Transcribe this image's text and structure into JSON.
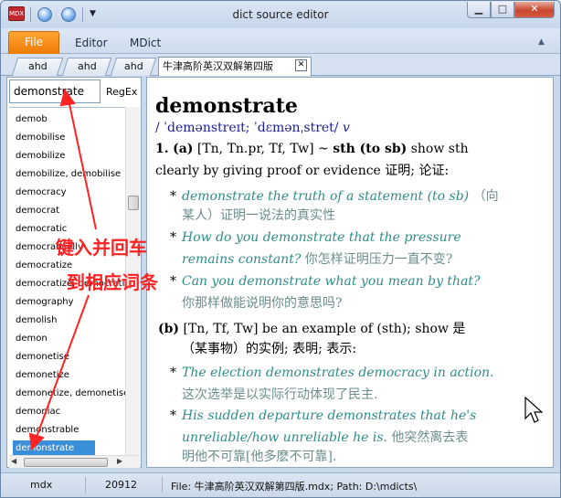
{
  "window": {
    "title": "dict source editor",
    "app_icon_text": "MDX"
  },
  "ribbon": {
    "file_tab": "File",
    "tabs": [
      "Editor",
      "MDict"
    ]
  },
  "doc_tabs": {
    "tabs": [
      "ahd",
      "ahd",
      "ahd"
    ],
    "active": "牛津高阶英汉双解第四版",
    "close_label": "✕"
  },
  "search": {
    "value": "demonstrate",
    "regex_label": "RegEx"
  },
  "word_list": [
    "demob",
    "demobilise",
    "demobilize",
    "demobilize, demobilise",
    "democracy",
    "democrat",
    "democratic",
    "democratically",
    "democratize",
    "democratize, democratise",
    "demography",
    "demolish",
    "demon",
    "demonetise",
    "demonetize",
    "demonetize, demonetise",
    "demoniac",
    "demonstrable",
    "demonstrate"
  ],
  "entry": {
    "headword": "demonstrate",
    "pronunciation": "/ ˈdemənstreɪt; ˈdɛmənˌstret/",
    "pos": "v",
    "sense1_num": "1.",
    "sense1_label": "(a)",
    "sense1_codes": "[Tn, Tn.pr, Tf, Tw] ~",
    "sense1_bold": "sth (to sb)",
    "sense1_def_a": "show sth",
    "sense1_def_b": "clearly by giving proof or evidence 证明; 论证:",
    "ex1_en": "demonstrate the truth of a statement (to sb)",
    "ex1_zh_a": "（向",
    "ex1_zh_b": "某人）证明一说法的真实性",
    "ex2_en_a": "How do you demonstrate that the pressure",
    "ex2_en_b": "remains constant?",
    "ex2_zh": "你怎样证明压力一直不变?",
    "ex3_en": "Can you demonstrate what you mean by that?",
    "ex3_zh": "你那样做能说明你的意思吗?",
    "sense2_label": "(b)",
    "sense2_def_a": "[Tn, Tf, Tw] be an example of (sth); show 是",
    "sense2_def_b": "（某事物）的实例; 表明; 表示:",
    "ex4_en": "The election demonstrates democracy in action.",
    "ex4_zh": "这次选举是以实际行动体现了民主.",
    "ex5_en_a": "His sudden departure demonstrates that he's",
    "ex5_en_b": "unreliable/how unreliable he is.",
    "ex5_zh_a": "他突然离去表",
    "ex5_zh_b": "明他不可靠[他多麽不可靠]."
  },
  "annotation": {
    "line1": "键入并回车",
    "line2": "到相应词条",
    "color": "#ff2222"
  },
  "status_bar": {
    "type": "mdx",
    "count": "20912",
    "file": "File: 牛津高阶英汉双解第四版.mdx;  Path: D:\\mdicts\\"
  }
}
